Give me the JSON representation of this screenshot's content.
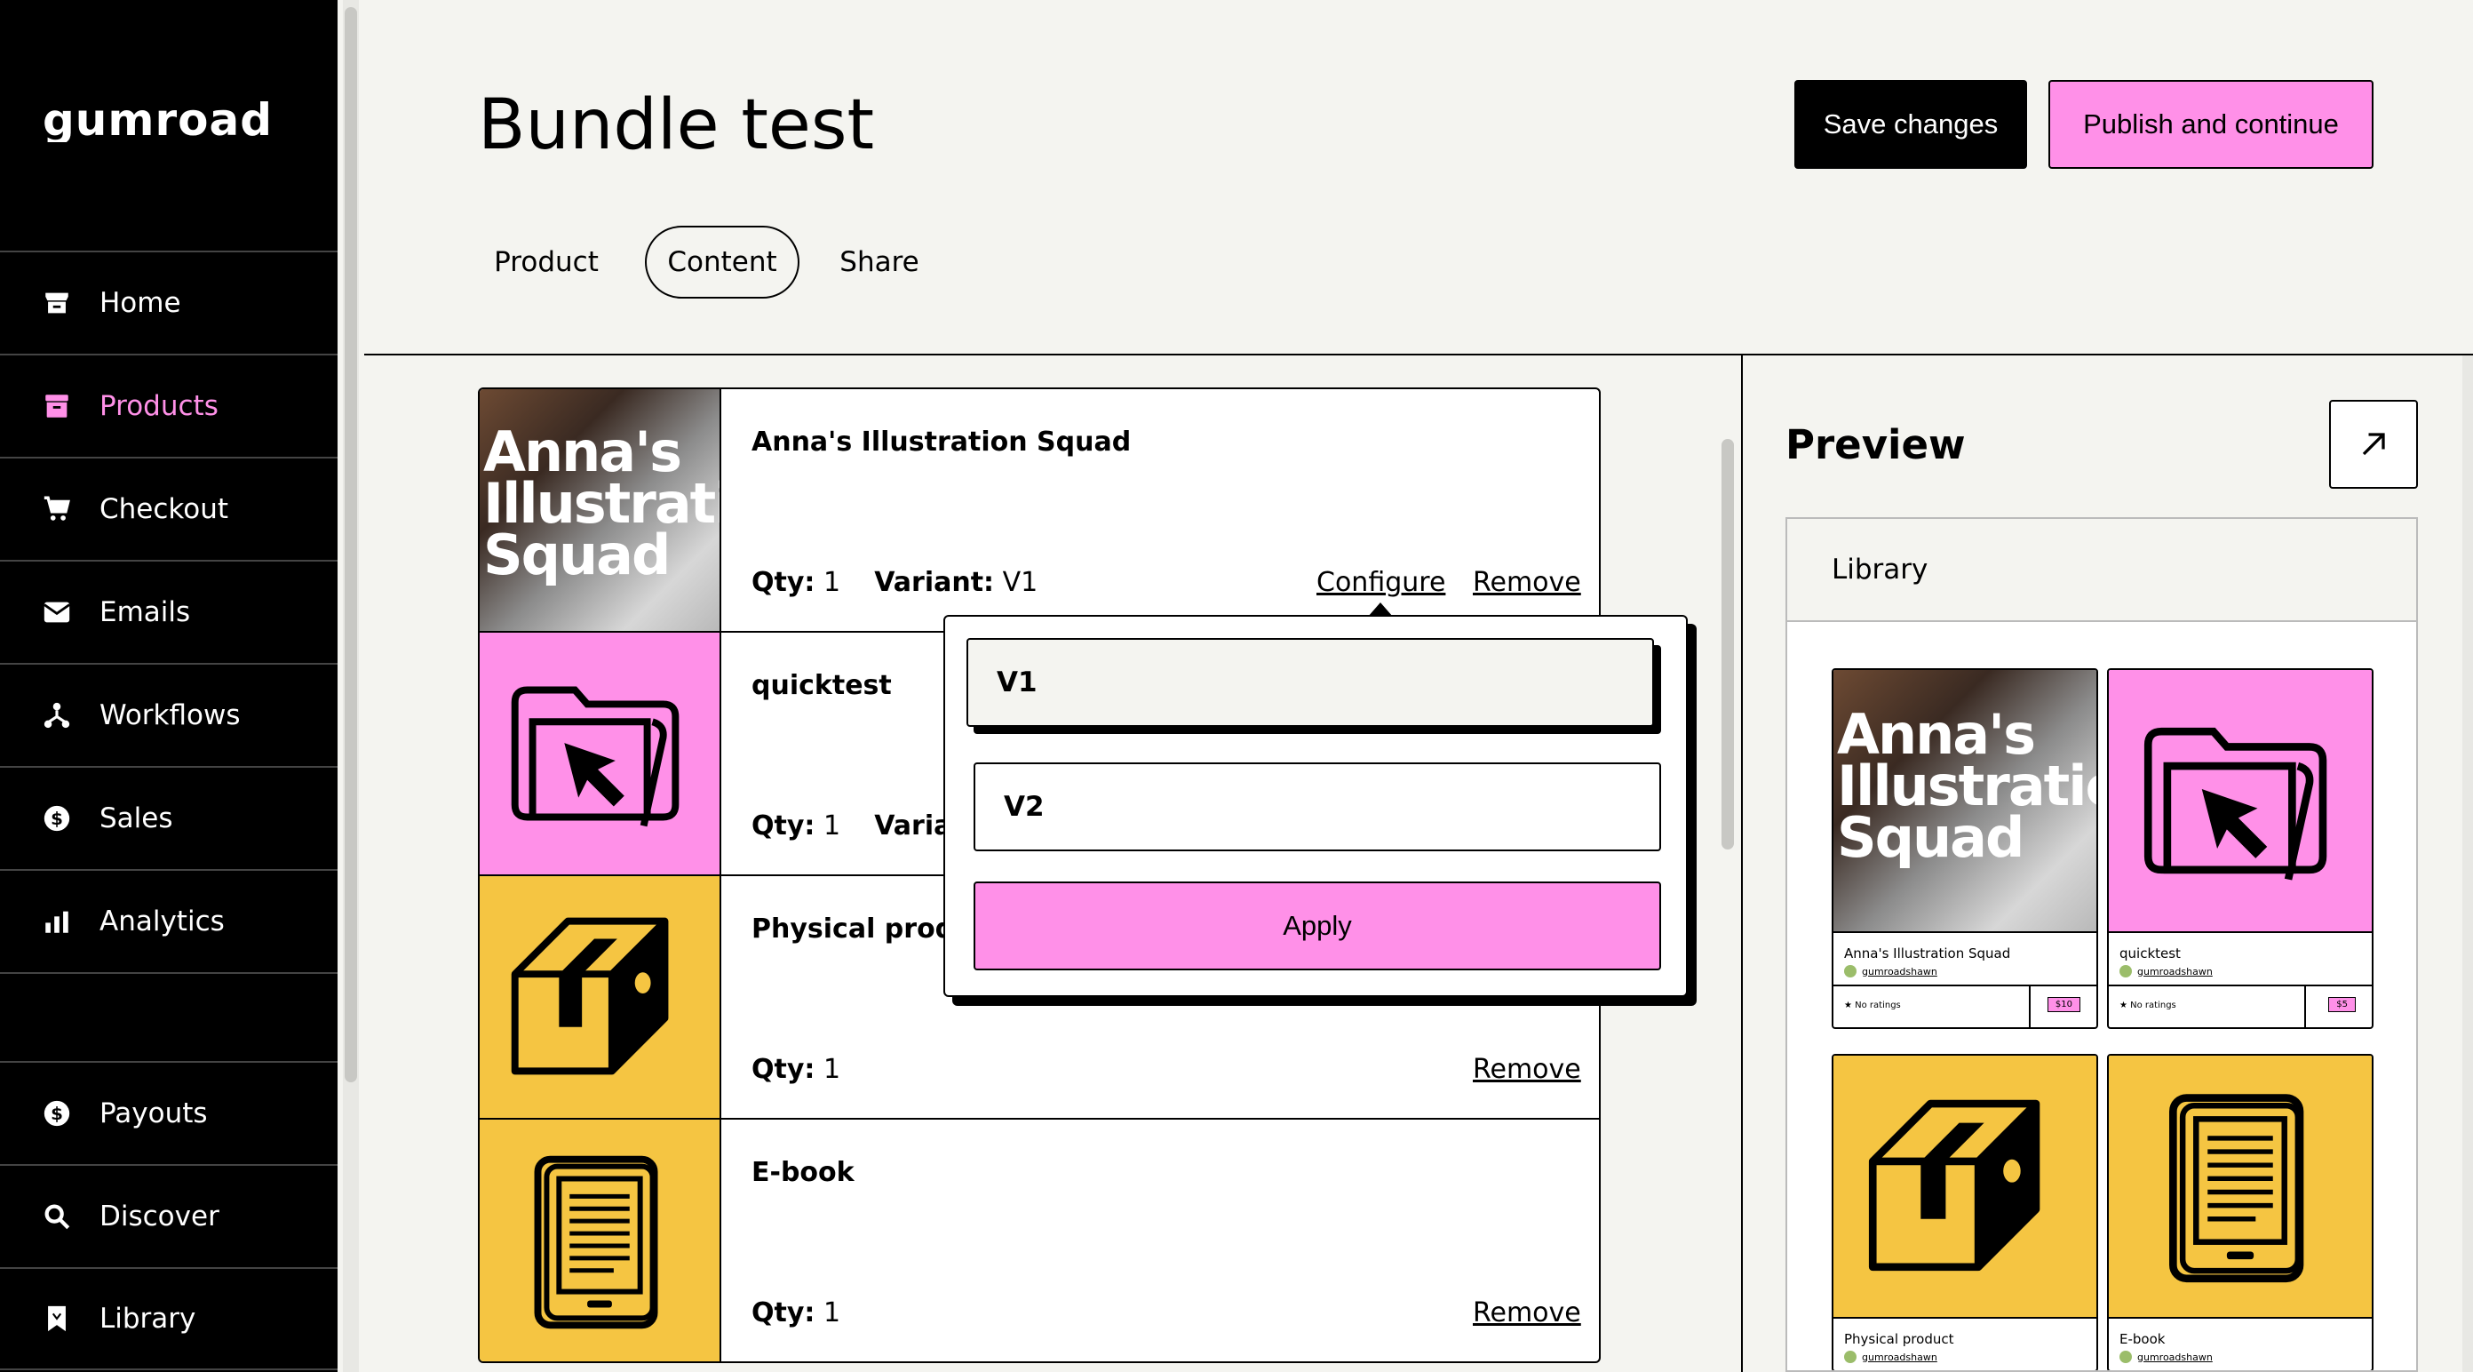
{
  "brand": {
    "logo_text": "GUMROAD",
    "accent": "#ff90e8",
    "yellow": "#f5c542"
  },
  "sidebar": {
    "items": [
      {
        "label": "Home",
        "icon": "store-icon"
      },
      {
        "label": "Products",
        "icon": "archive-icon",
        "active": true
      },
      {
        "label": "Checkout",
        "icon": "cart-icon"
      },
      {
        "label": "Emails",
        "icon": "envelope-icon"
      },
      {
        "label": "Workflows",
        "icon": "workflow-icon"
      },
      {
        "label": "Sales",
        "icon": "dollar-circle-icon"
      },
      {
        "label": "Analytics",
        "icon": "bar-chart-icon"
      },
      {
        "label": "Payouts",
        "icon": "dollar-circle-icon"
      },
      {
        "label": "Discover",
        "icon": "search-icon"
      },
      {
        "label": "Library",
        "icon": "bookmark-icon"
      }
    ]
  },
  "header": {
    "title": "Bundle test",
    "save_label": "Save changes",
    "publish_label": "Publish and continue",
    "tabs": [
      {
        "label": "Product"
      },
      {
        "label": "Content",
        "active": true
      },
      {
        "label": "Share"
      }
    ]
  },
  "products": [
    {
      "name": "Anna's Illustration Squad",
      "qty_label": "Qty:",
      "qty": "1",
      "variant_label": "Variant:",
      "variant": "V1",
      "configure": "Configure",
      "remove": "Remove",
      "thumb_text": [
        "Anna's",
        "Illustratio",
        "Squad"
      ]
    },
    {
      "name": "quicktest",
      "qty_label": "Qty:",
      "qty": "1",
      "variant_label": "Variant"
    },
    {
      "name": "Physical produ",
      "qty_label": "Qty:",
      "qty": "1",
      "remove": "Remove"
    },
    {
      "name": "E-book",
      "qty_label": "Qty:",
      "qty": "1",
      "remove": "Remove"
    }
  ],
  "variant_popover": {
    "options": [
      "V1",
      "V2"
    ],
    "selected": "V1",
    "apply_label": "Apply"
  },
  "preview": {
    "title": "Preview",
    "library_label": "Library",
    "cards": [
      {
        "name": "Anna's Illustration Squad",
        "author": "gumroadshawn",
        "rating": "No ratings",
        "price": "$10"
      },
      {
        "name": "quicktest",
        "author": "gumroadshawn",
        "rating": "No ratings",
        "price": "$5"
      },
      {
        "name": "Physical product",
        "author": "gumroadshawn"
      },
      {
        "name": "E-book",
        "author": "gumroadshawn"
      }
    ]
  }
}
